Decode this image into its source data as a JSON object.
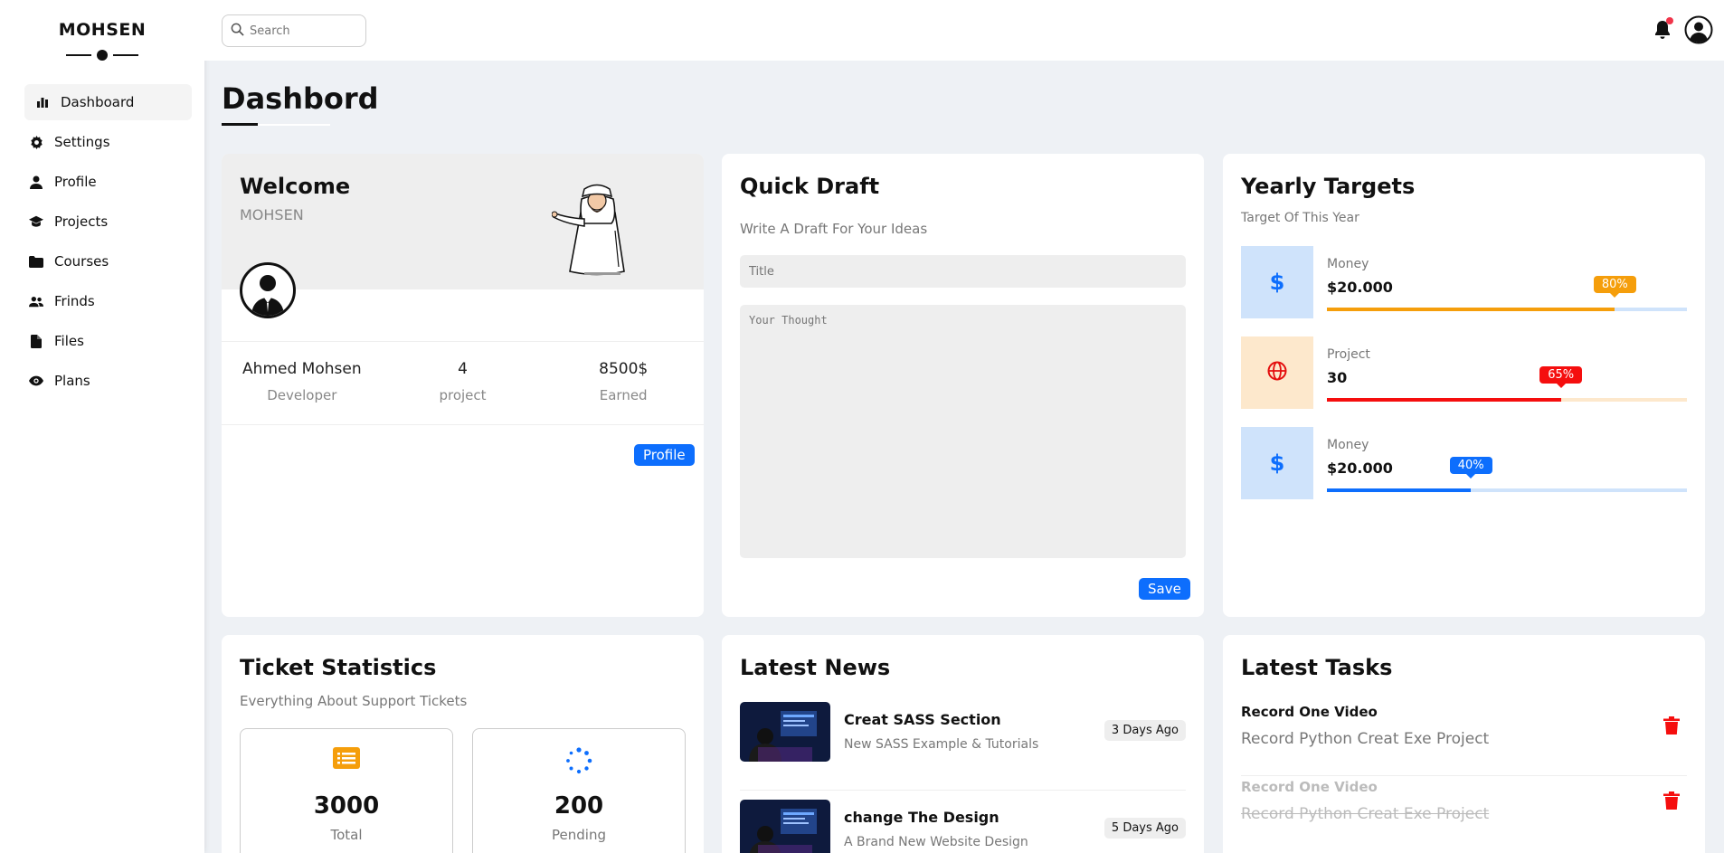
{
  "brand": "MOHSEN",
  "nav": [
    {
      "label": "Dashboard",
      "icon": "chart-bar-icon",
      "active": true
    },
    {
      "label": "Settings",
      "icon": "gear-icon"
    },
    {
      "label": "Profile",
      "icon": "user-icon"
    },
    {
      "label": "Projects",
      "icon": "graduation-cap-icon"
    },
    {
      "label": "Courses",
      "icon": "folder-icon"
    },
    {
      "label": "Frinds",
      "icon": "users-icon"
    },
    {
      "label": "Files",
      "icon": "file-icon"
    },
    {
      "label": "Plans",
      "icon": "eye-icon"
    }
  ],
  "search": {
    "placeholder": "Search"
  },
  "page_title": "Dashbord",
  "welcome": {
    "title": "Welcome",
    "name": "MOHSEN",
    "stats": [
      {
        "value": "Ahmed Mohsen",
        "label": "Developer"
      },
      {
        "value": "4",
        "label": "project"
      },
      {
        "value": "8500$",
        "label": "Earned"
      }
    ],
    "button": "Profile"
  },
  "quick_draft": {
    "title": "Quick Draft",
    "subtitle": "Write A Draft For Your Ideas",
    "title_placeholder": "Title",
    "thought_placeholder": "Your Thought",
    "button": "Save"
  },
  "targets": {
    "title": "Yearly Targets",
    "subtitle": "Target Of This Year",
    "items": [
      {
        "label": "Money",
        "value": "$20.000",
        "percent": 80,
        "percent_label": "80%",
        "color": "#f59e0b",
        "track": "#cfe3fb",
        "icon_bg": "#cfe3fb",
        "icon": "dollar-icon",
        "icon_color": "#0d6efd"
      },
      {
        "label": "Project",
        "value": "30",
        "percent": 65,
        "percent_label": "65%",
        "color": "#f50e0e",
        "track": "#fde8cc",
        "icon_bg": "#fde8cc",
        "icon": "globe-icon",
        "icon_color": "#e40e0e"
      },
      {
        "label": "Money",
        "value": "$20.000",
        "percent": 40,
        "percent_label": "40%",
        "color": "#0d6efd",
        "track": "#cfe3fb",
        "icon_bg": "#cfe3fb",
        "icon": "dollar-icon",
        "icon_color": "#0d6efd"
      }
    ]
  },
  "tickets": {
    "title": "Ticket Statistics",
    "subtitle": "Everything About Support Tickets",
    "items": [
      {
        "value": "3000",
        "label": "Total",
        "icon": "list-icon",
        "color": "#f59e0b"
      },
      {
        "value": "200",
        "label": "Pending",
        "icon": "spinner-icon",
        "color": "#0d6efd"
      }
    ]
  },
  "news": {
    "title": "Latest News",
    "items": [
      {
        "title": "Creat SASS Section",
        "desc": "New SASS Example & Tutorials",
        "date": "3 Days Ago"
      },
      {
        "title": "change The Design",
        "desc": "A Brand New Website Design",
        "date": "5 Days Ago"
      }
    ]
  },
  "tasks": {
    "title": "Latest Tasks",
    "items": [
      {
        "title": "Record One Video",
        "desc": "Record Python Creat Exe Project",
        "done": false
      },
      {
        "title": "Record One Video",
        "desc": "Record Python Creat Exe Project",
        "done": true
      }
    ]
  }
}
